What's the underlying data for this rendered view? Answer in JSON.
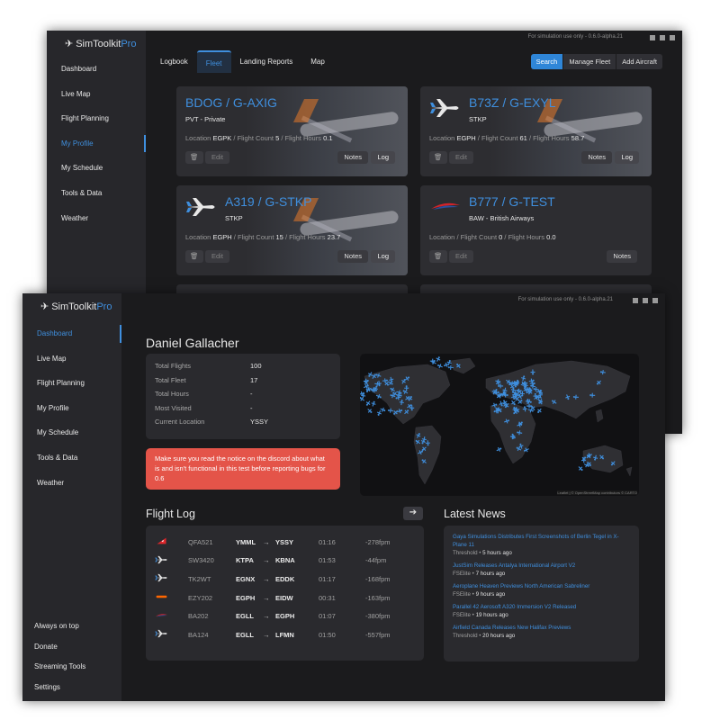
{
  "app": {
    "name_main": "SimToolkit",
    "name_pro": "Pro",
    "version_notice": "For simulation use only - 0.6.0-alpha.21"
  },
  "back_window": {
    "sidebar": [
      {
        "label": "Dashboard",
        "active": false
      },
      {
        "label": "Live Map",
        "active": false
      },
      {
        "label": "Flight Planning",
        "active": false
      },
      {
        "label": "My Profile",
        "active": true
      },
      {
        "label": "My Schedule",
        "active": false
      },
      {
        "label": "Tools & Data",
        "active": false
      },
      {
        "label": "Weather",
        "active": false
      }
    ],
    "tabs": [
      {
        "label": "Logbook",
        "active": false
      },
      {
        "label": "Fleet",
        "active": true
      },
      {
        "label": "Landing Reports",
        "active": false
      },
      {
        "label": "Map",
        "active": false
      }
    ],
    "buttons": {
      "search": "Search",
      "manage_fleet": "Manage Fleet",
      "add_aircraft": "Add Aircraft"
    },
    "fleet": [
      {
        "title": "BDOG / G-AXIG",
        "subtitle": "PVT - Private",
        "location_label": "Location",
        "location": "EGPK",
        "count_label": "Flight Count",
        "count": "5",
        "hours_label": "Flight Hours",
        "hours": "0.1",
        "icon": "none",
        "photo": true
      },
      {
        "title": "B73Z / G-EXYL",
        "subtitle": "STKP",
        "location_label": "Location",
        "location": "EGPH",
        "count_label": "Flight Count",
        "count": "61",
        "hours_label": "Flight Hours",
        "hours": "58.7",
        "icon": "airplane-icon",
        "photo": true
      },
      {
        "title": "A319 / G-STKP",
        "subtitle": "STKP",
        "location_label": "Location",
        "location": "EGPH",
        "count_label": "Flight Count",
        "count": "15",
        "hours_label": "Flight Hours",
        "hours": "23.7",
        "icon": "airplane-icon",
        "photo": true
      },
      {
        "title": "B777 / G-TEST",
        "subtitle": "BAW - British Airways",
        "location_label": "Location",
        "location": "",
        "count_label": "Flight Count",
        "count": "0",
        "hours_label": "Flight Hours",
        "hours": "0.0",
        "icon": "british-airways-icon",
        "photo": false
      }
    ],
    "card_buttons": {
      "edit": "Edit",
      "notes": "Notes",
      "log": "Log"
    }
  },
  "front_window": {
    "sidebar": [
      {
        "label": "Dashboard",
        "active": true
      },
      {
        "label": "Live Map",
        "active": false
      },
      {
        "label": "Flight Planning",
        "active": false
      },
      {
        "label": "My Profile",
        "active": false
      },
      {
        "label": "My Schedule",
        "active": false
      },
      {
        "label": "Tools & Data",
        "active": false
      },
      {
        "label": "Weather",
        "active": false
      }
    ],
    "sidebar_bottom": [
      {
        "label": "Always on top"
      },
      {
        "label": "Donate"
      },
      {
        "label": "Streaming Tools"
      },
      {
        "label": "Settings"
      }
    ],
    "user_name": "Daniel Gallacher",
    "stats": [
      {
        "key": "Total Flights",
        "value": "100"
      },
      {
        "key": "Total Fleet",
        "value": "17"
      },
      {
        "key": "Total Hours",
        "value": "-"
      },
      {
        "key": "Most Visited",
        "value": "-"
      },
      {
        "key": "Current Location",
        "value": "YSSY"
      }
    ],
    "alert": "Make sure you read the notice on the discord about what is and isn't functional in this test before reporting bugs for 0.6",
    "map_attribution": "Leaflet | © OpenStreetMap contributors © CARTO",
    "flight_log_title": "Flight Log",
    "flight_log": [
      {
        "icon": "qantas-icon",
        "callsign": "QFA521",
        "dep": "YMML",
        "arr": "YSSY",
        "time": "01:16",
        "fpm": "-278fpm"
      },
      {
        "icon": "airplane-icon",
        "callsign": "SW3420",
        "dep": "KTPA",
        "arr": "KBNA",
        "time": "01:53",
        "fpm": "-44fpm"
      },
      {
        "icon": "airplane-icon",
        "callsign": "TK2WT",
        "dep": "EGNX",
        "arr": "EDDK",
        "time": "01:17",
        "fpm": "-168fpm"
      },
      {
        "icon": "easyjet-icon",
        "callsign": "EZY202",
        "dep": "EGPH",
        "arr": "EIDW",
        "time": "00:31",
        "fpm": "-163fpm"
      },
      {
        "icon": "british-airways-icon",
        "callsign": "BA202",
        "dep": "EGLL",
        "arr": "EGPH",
        "time": "01:07",
        "fpm": "-380fpm"
      },
      {
        "icon": "airplane-icon",
        "callsign": "BA124",
        "dep": "EGLL",
        "arr": "LFMN",
        "time": "01:50",
        "fpm": "-557fpm"
      }
    ],
    "news_title": "Latest News",
    "news": [
      {
        "title": "Gaya Simulations Distributes First Screenshots of Berlin Tegel in X-Plane 11",
        "source": "Threshold",
        "ago": "5 hours ago"
      },
      {
        "title": "JustSim Releases Antalya International Airport V2",
        "source": "FSElite",
        "ago": "7 hours ago"
      },
      {
        "title": "Aeroplane Heaven Previews North American Sabreliner",
        "source": "FSElite",
        "ago": "9 hours ago"
      },
      {
        "title": "Parallel 42 Aerosoft A320 Immersion V2 Released",
        "source": "FSElite",
        "ago": "19 hours ago"
      },
      {
        "title": "Airfield Canada Releases New Halifax Previews",
        "source": "Threshold",
        "ago": "20 hours ago"
      }
    ]
  },
  "colors": {
    "accent": "#3f8fde",
    "alert": "#e45449",
    "window_bg": "#1b1b1d",
    "sidebar_bg": "#27272b",
    "card_bg": "#2d2d31"
  }
}
